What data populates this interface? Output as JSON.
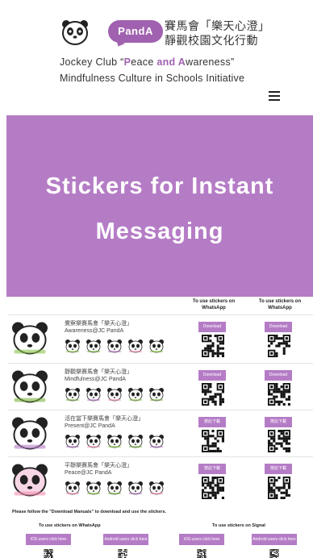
{
  "header": {
    "brand_badge": "PandA",
    "title_cn_line1": "賽馬會「樂天心澄」",
    "title_cn_line2": "靜觀校園文化行動",
    "title_en_prefix": "Jockey Club “",
    "title_en_peace_p": "P",
    "title_en_peace_rest": "eace",
    "title_en_and": " and ",
    "title_en_aware_a": "A",
    "title_en_aware_rest": "wareness",
    "title_en_suffix": "”",
    "subtitle_en": "Mindfulness Culture in Schools Initiative",
    "menu_icon": "hamburger-menu-icon"
  },
  "hero": {
    "line1": "Stickers for Instant",
    "line2": "Messaging"
  },
  "table": {
    "col_whatsapp": "To use stickers on WhatsApp",
    "col_other": "To use stickers on WhatsApp",
    "rows": [
      {
        "name_cn": "覺察樂賽馬會「樂天心澄」",
        "name_en": "Awareness@JC PandA",
        "btn1": "Download",
        "btn2": "Download"
      },
      {
        "name_cn": "靜觀樂賽馬會「樂天心澄」",
        "name_en": "Mindfulness@JC PandA",
        "btn1": "Download",
        "btn2": "Download"
      },
      {
        "name_cn": "活在當下樂賽馬會「樂天心澄」",
        "name_en": "Present@JC PandA",
        "btn1": "按此下載",
        "btn2": "按此下載"
      },
      {
        "name_cn": "平靜樂賽馬會「樂天心澄」",
        "name_en": "Peace@JC PandA",
        "btn1": "按此下載",
        "btn2": "按此下載"
      }
    ]
  },
  "footer": {
    "instructions": "Please follow the \"Download Manuals\" to download and use the stickers.",
    "whatsapp_head": "To use stickers on WhatsApp",
    "signal_head": "To use stickers on Signal",
    "buttons": [
      "iOS users click here",
      "Android users click here",
      "iOS users click here",
      "Android users click here"
    ]
  },
  "colors": {
    "accent": "#b57cc6",
    "brand": "#a062b0"
  }
}
